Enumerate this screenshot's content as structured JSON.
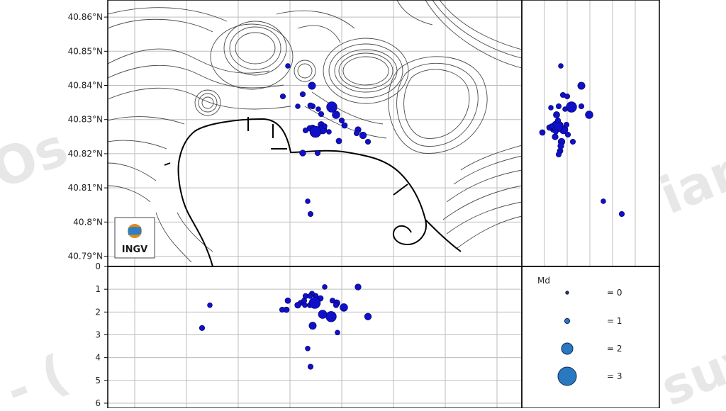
{
  "logo": {
    "text": "INGV"
  },
  "watermark": {
    "left": "Os",
    "right": "ian",
    "bottom_left": "- (",
    "bottom_right": "suv"
  },
  "colors": {
    "event": "#1010c8",
    "event_stroke": "#000060",
    "legend_fill": "#2a78c0",
    "contour": "#4a4a4a",
    "coast": "#000000",
    "grid": "#bdbdbd"
  },
  "chart_data": {
    "type": "scatter",
    "map": {
      "lat_ticks": [
        "40.86°N",
        "40.85°N",
        "40.84°N",
        "40.83°N",
        "40.82°N",
        "40.81°N",
        "40.8°N",
        "40.79°N"
      ],
      "lat_values": [
        40.86,
        40.85,
        40.84,
        40.83,
        40.82,
        40.81,
        40.8,
        40.79
      ]
    },
    "depth": {
      "ticks": [
        "0",
        "1",
        "2",
        "3",
        "4",
        "5",
        "6"
      ],
      "range": [
        0,
        6
      ]
    },
    "legend": {
      "title": "Md",
      "entries": [
        {
          "label": "= 0",
          "md": 0
        },
        {
          "label": "= 1",
          "md": 1
        },
        {
          "label": "= 2",
          "md": 2
        },
        {
          "label": "= 3",
          "md": 3
        }
      ]
    },
    "events": [
      {
        "md": 0.6
      },
      {
        "md": 0.7
      },
      {
        "md": 1.2
      },
      {
        "md": 0.7
      },
      {
        "md": 0.6
      },
      {
        "md": 0.7
      },
      {
        "md": 2.0
      },
      {
        "md": 0.7
      },
      {
        "md": 1.3
      },
      {
        "md": 1.0
      },
      {
        "md": 0.8
      },
      {
        "md": 1.5
      },
      {
        "md": 0.7
      },
      {
        "md": 0.8
      },
      {
        "md": 0.9
      },
      {
        "md": 1.1
      },
      {
        "md": 0.7
      },
      {
        "md": 0.8
      },
      {
        "md": 0.7
      },
      {
        "md": 0.9
      },
      {
        "md": 0.7
      },
      {
        "md": 0.8
      },
      {
        "md": 2.2
      },
      {
        "md": 0.6
      },
      {
        "md": 0.7
      },
      {
        "md": 0.7
      },
      {
        "md": 0.6
      },
      {
        "md": 0.7
      },
      {
        "md": 0.6
      },
      {
        "md": 0.6
      }
    ]
  }
}
